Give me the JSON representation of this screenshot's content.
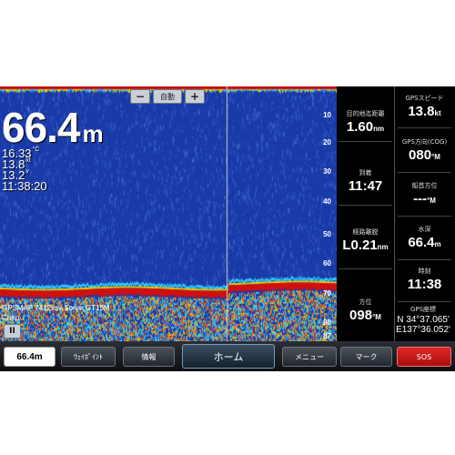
{
  "sonar": {
    "zoom_minus": "−",
    "zoom_label": "自動",
    "zoom_plus": "+",
    "depth_value": "66.4",
    "depth_unit": "m",
    "temperature": "16.33",
    "temperature_unit": "°C",
    "speed": "13.8",
    "speed_unit": "kt",
    "voltage": "13.2",
    "voltage_unit": "v",
    "time": "11:38:20",
    "scale_ticks": [
      "10",
      "20",
      "30",
      "40",
      "50",
      "60",
      "70",
      "80",
      "87"
    ],
    "caption": "GPSMAP 7412xsv Sonar:GT15M",
    "frequency_label": "Chirp",
    "pause_icon": "II",
    "colors": {
      "background": "#1a3aa8",
      "bottom_return": "#d01010"
    }
  },
  "data_fields": {
    "left": [
      {
        "label": "目的地迄距離",
        "value": "1.60",
        "unit": "nm"
      },
      {
        "label": "到着",
        "value": "11:47",
        "unit": ""
      },
      {
        "label": "経路離脱",
        "value": "L0.21",
        "unit": "nm"
      },
      {
        "label": "方位",
        "value": "098",
        "unit": "°M"
      }
    ],
    "right": [
      {
        "label": "GPSスピード",
        "value": "13.8",
        "unit": "kt"
      },
      {
        "label": "GPS方向(COG)",
        "value": "080",
        "unit": "°M"
      },
      {
        "label": "船首方位",
        "value": "---",
        "unit": "°M"
      },
      {
        "label": "水深",
        "value": "66.4",
        "unit": "m"
      },
      {
        "label": "時刻",
        "value": "11:38",
        "unit": ""
      },
      {
        "label": "GPS座標",
        "value_line1": "N  34°37.065'",
        "value_line2": "E137°36.052'"
      }
    ]
  },
  "bottom_bar": {
    "depth": "66.4m",
    "waypoint": "ｳｪｲﾎﾟｲﾝﾄ",
    "info": "情報",
    "home": "ホーム",
    "menu": "メニュー",
    "mark": "マーク",
    "sos": "SOS"
  }
}
